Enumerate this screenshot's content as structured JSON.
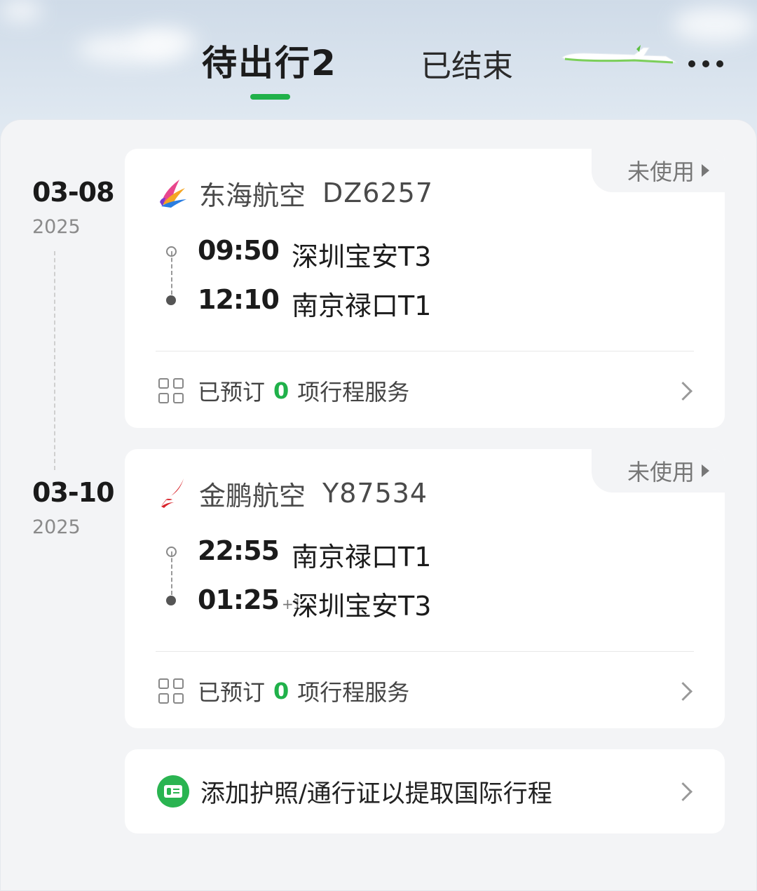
{
  "header": {
    "tab_upcoming": "待出行2",
    "tab_finished": "已结束",
    "more_icon": "more-dots-icon",
    "accent_color": "#20b14a"
  },
  "trips": [
    {
      "date": "03-08",
      "year": "2025",
      "status": "未使用",
      "airline": "东海航空",
      "flight_no": "DZ6257",
      "logo_icon": "donghai-airlines-logo",
      "dep_time": "09:50",
      "dep_airport": "深圳宝安T3",
      "arr_time": "12:10",
      "arr_plus": "",
      "arr_airport": "南京禄口T1",
      "service_prefix": "已预订",
      "service_count": "0",
      "service_suffix": "项行程服务"
    },
    {
      "date": "03-10",
      "year": "2025",
      "status": "未使用",
      "airline": "金鹏航空",
      "flight_no": "Y87534",
      "logo_icon": "jinpeng-airlines-logo",
      "dep_time": "22:55",
      "dep_airport": "南京禄口T1",
      "arr_time": "01:25",
      "arr_plus": "+1",
      "arr_airport": "深圳宝安T3",
      "service_prefix": "已预订",
      "service_count": "0",
      "service_suffix": "项行程服务"
    }
  ],
  "passport": {
    "label": "添加护照/通行证以提取国际行程",
    "icon": "id-card-icon"
  }
}
